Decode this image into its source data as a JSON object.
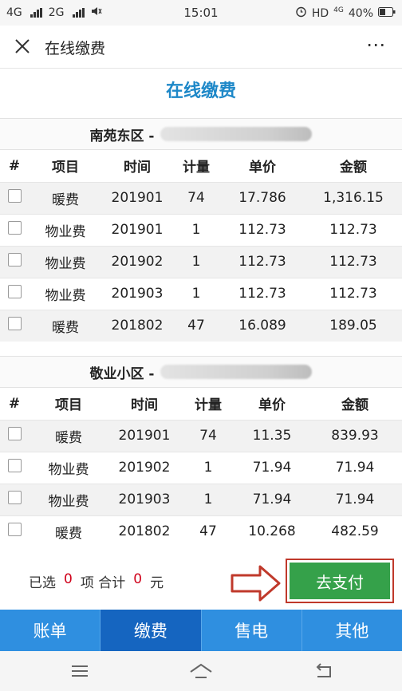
{
  "status_bar": {
    "network_1": "4G",
    "network_2": "2G",
    "time": "15:01",
    "hd": "HD",
    "net_4g": "4G",
    "battery": "40%"
  },
  "title_bar": {
    "close_icon": "close-icon",
    "title": "在线缴费",
    "more_label": "⋯"
  },
  "page_heading": "在线缴费",
  "sections": [
    {
      "community": "南苑东区 -",
      "columns": [
        "#",
        "项目",
        "时间",
        "计量",
        "单价",
        "金额"
      ],
      "rows": [
        {
          "item": "暖费",
          "period": "201901",
          "qty": "74",
          "price": "17.786",
          "amount": "1,316.15"
        },
        {
          "item": "物业费",
          "period": "201901",
          "qty": "1",
          "price": "112.73",
          "amount": "112.73"
        },
        {
          "item": "物业费",
          "period": "201902",
          "qty": "1",
          "price": "112.73",
          "amount": "112.73"
        },
        {
          "item": "物业费",
          "period": "201903",
          "qty": "1",
          "price": "112.73",
          "amount": "112.73"
        },
        {
          "item": "暖费",
          "period": "201802",
          "qty": "47",
          "price": "16.089",
          "amount": "189.05"
        }
      ]
    },
    {
      "community": "敬业小区 -",
      "columns": [
        "#",
        "项目",
        "时间",
        "计量",
        "单价",
        "金额"
      ],
      "rows": [
        {
          "item": "暖费",
          "period": "201901",
          "qty": "74",
          "price": "11.35",
          "amount": "839.93"
        },
        {
          "item": "物业费",
          "period": "201902",
          "qty": "1",
          "price": "71.94",
          "amount": "71.94"
        },
        {
          "item": "物业费",
          "period": "201903",
          "qty": "1",
          "price": "71.94",
          "amount": "71.94"
        },
        {
          "item": "暖费",
          "period": "201802",
          "qty": "47",
          "price": "10.268",
          "amount": "482.59"
        }
      ]
    }
  ],
  "summary": {
    "selected_label": "已选",
    "selected_count": "0",
    "items_label": "项 合计",
    "total": "0",
    "currency": "元"
  },
  "pay_button": "去支付",
  "tabs": [
    {
      "label": "账单",
      "active": false
    },
    {
      "label": "缴费",
      "active": true
    },
    {
      "label": "售电",
      "active": false
    },
    {
      "label": "其他",
      "active": false
    }
  ],
  "colors": {
    "heading": "#1e88c8",
    "pay_button": "#35a14a",
    "tab_bar": "#2f8fe0",
    "tab_active": "#1565c0",
    "highlight_red": "#d0021b"
  }
}
